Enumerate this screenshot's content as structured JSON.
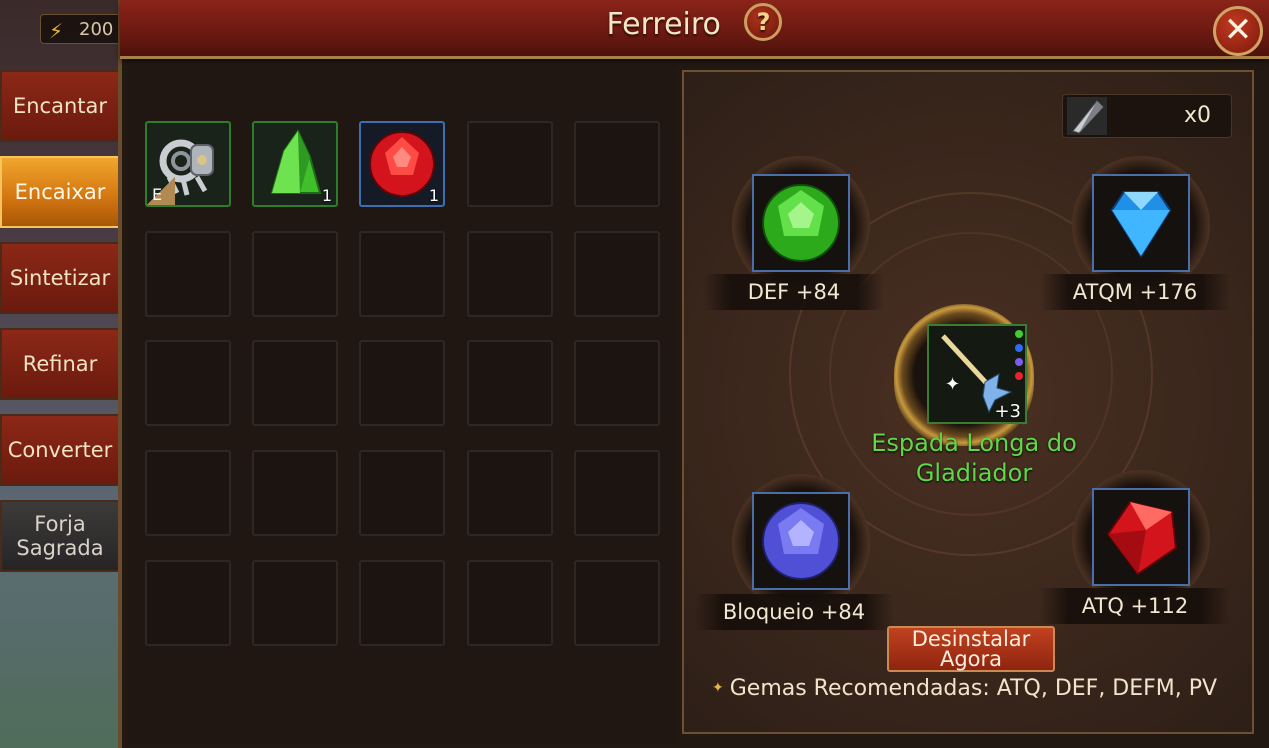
{
  "header": {
    "title": "Ferreiro",
    "help_label": "?",
    "close_label": "✕"
  },
  "resources": {
    "energy": "200"
  },
  "tabs": [
    {
      "label": "Encantar",
      "active": false
    },
    {
      "label": "Encaixar",
      "active": true
    },
    {
      "label": "Sintetizar",
      "active": false
    },
    {
      "label": "Refinar",
      "active": false
    },
    {
      "label": "Converter",
      "active": false
    },
    {
      "label": "Forja Sagrada",
      "active": false
    }
  ],
  "inventory": {
    "items": [
      {
        "icon": "gem-removal-tool-icon",
        "badge": "E"
      },
      {
        "icon": "green-crystal-icon",
        "count": "1"
      },
      {
        "icon": "red-gem-icon",
        "count": "1"
      }
    ]
  },
  "socket": {
    "extractor_count": "x0",
    "weapon_name": "Espada Longa do Gladiador",
    "weapon_level": "+3",
    "gems": [
      {
        "label": "DEF +84",
        "icon": "green-gem-icon",
        "color": "#3fce2c"
      },
      {
        "label": "ATQM +176",
        "icon": "blue-diamond-icon",
        "color": "#2ea4f5"
      },
      {
        "label": "Bloqueio +84",
        "icon": "violet-gem-icon",
        "color": "#6d6df0"
      },
      {
        "label": "ATQ +112",
        "icon": "red-ruby-icon",
        "color": "#e8242e"
      }
    ],
    "uninstall_label": "Desinstalar Agora",
    "recommended": "Gemas Recomendadas: ATQ, DEF, DEFM, PV"
  },
  "colors": {
    "accent": "#d27410",
    "title_bar": "#6d1a12",
    "gem_name": "#5fd84a"
  }
}
